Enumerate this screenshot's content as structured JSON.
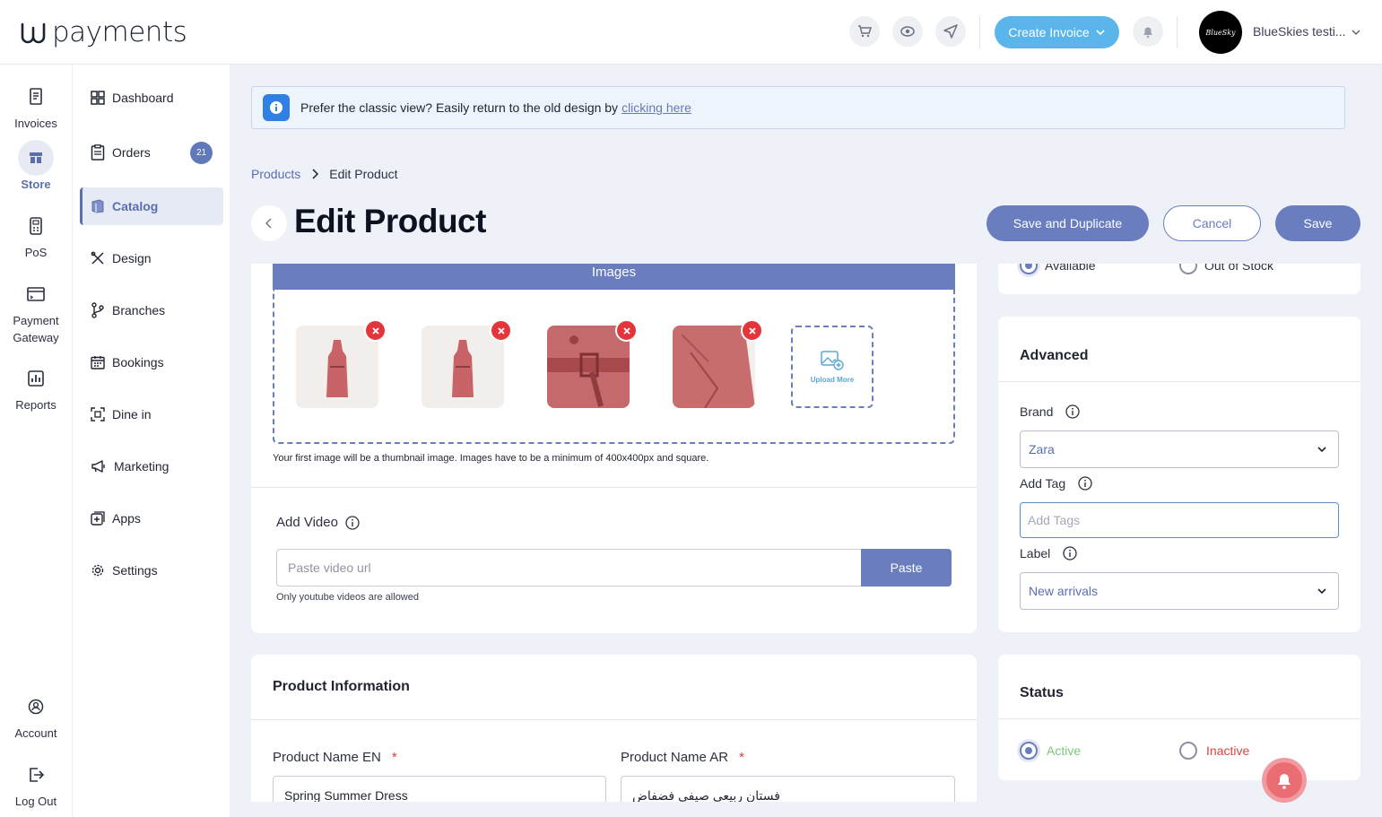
{
  "brand": {
    "logo_text": "payments"
  },
  "topbar": {
    "create_invoice": "Create Invoice",
    "account_name": "BlueSkies testi...",
    "avatar_text": "BlueSky"
  },
  "rail": {
    "invoices": "Invoices",
    "store": "Store",
    "pos": "PoS",
    "payment_gateway_1": "Payment",
    "payment_gateway_2": "Gateway",
    "reports": "Reports",
    "account": "Account",
    "logout": "Log Out"
  },
  "nav": {
    "dashboard": "Dashboard",
    "orders": "Orders",
    "orders_badge": "21",
    "catalog": "Catalog",
    "design": "Design",
    "branches": "Branches",
    "bookings": "Bookings",
    "dine_in": "Dine in",
    "marketing": "Marketing",
    "apps": "Apps",
    "settings": "Settings"
  },
  "notice": {
    "text": "Prefer the classic view? Easily return to the old design by",
    "link": "clicking here"
  },
  "breadcrumb": {
    "parent": "Products",
    "current": "Edit Product"
  },
  "page": {
    "title": "Edit Product",
    "save_duplicate": "Save and Duplicate",
    "cancel": "Cancel",
    "save": "Save"
  },
  "images": {
    "header": "Images",
    "upload_more": "Upload More",
    "note": "Your first image will be a thumbnail image. Images have to be a minimum of 400x400px and square."
  },
  "video": {
    "label": "Add Video",
    "placeholder": "Paste video url",
    "paste": "Paste",
    "note": "Only youtube videos are allowed"
  },
  "product_info": {
    "title": "Product Information",
    "name_en_label": "Product Name EN",
    "name_en_value": "Spring Summer Dress",
    "name_ar_label": "Product Name AR",
    "name_ar_value": "فستان ربيعي صيفي فضفاض",
    "required_mark": "*"
  },
  "stock": {
    "available": "Available",
    "out_of_stock": "Out of Stock"
  },
  "advanced": {
    "title": "Advanced",
    "brand_label": "Brand",
    "brand_value": "Zara",
    "tag_label": "Add Tag",
    "tag_placeholder": "Add Tags",
    "label_label": "Label",
    "label_value": "New arrivals"
  },
  "status": {
    "title": "Status",
    "active": "Active",
    "inactive": "Inactive"
  },
  "colors": {
    "accent": "#6a7dbe",
    "create_btn": "#5ab6ea",
    "danger": "#e3363c",
    "active_green": "#7cc77c"
  }
}
